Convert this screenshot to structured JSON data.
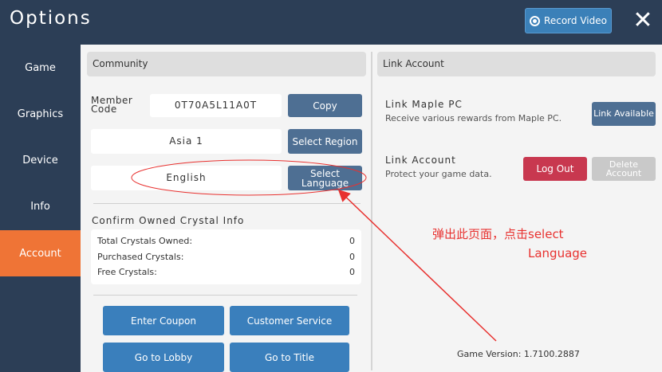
{
  "header": {
    "title": "Options",
    "record_label": "Record Video"
  },
  "sidebar": {
    "items": [
      {
        "label": "Game"
      },
      {
        "label": "Graphics"
      },
      {
        "label": "Device"
      },
      {
        "label": "Info"
      },
      {
        "label": "Account",
        "active": true
      }
    ]
  },
  "community": {
    "header": "Community",
    "member_code_label": "Member Code",
    "member_code_value": "0T70A5L11A0T",
    "copy_label": "Copy",
    "region_value": "Asia 1",
    "select_region_label": "Select Region",
    "language_value": "English",
    "select_language_label": "Select Language"
  },
  "crystals": {
    "title": "Confirm Owned Crystal Info",
    "rows": [
      {
        "label": "Total Crystals Owned:",
        "value": "0"
      },
      {
        "label": "Purchased Crystals:",
        "value": "0"
      },
      {
        "label": "Free Crystals:",
        "value": "0"
      }
    ]
  },
  "actions": {
    "enter_coupon": "Enter Coupon",
    "customer_service": "Customer Service",
    "go_to_lobby": "Go to Lobby",
    "go_to_title": "Go to Title"
  },
  "link_account": {
    "header": "Link Account",
    "maple_title": "Link Maple PC",
    "maple_desc": "Receive various rewards from Maple PC.",
    "maple_button": "Link Available",
    "account_title": "Link Account",
    "account_desc": "Protect your game data.",
    "logout_button": "Log Out",
    "delete_button": "Delete Account"
  },
  "version": "Game Version: 1.7100.2887",
  "annotation": {
    "line1": "弹出此页面，点击select",
    "line2": "Language"
  },
  "colors": {
    "sidebar_bg": "#2c3e56",
    "active_tab": "#ef7436",
    "primary_button": "#3a7fbc",
    "secondary_button": "#4e6f93",
    "danger_button": "#c8384f",
    "annotation": "#e8312f"
  }
}
